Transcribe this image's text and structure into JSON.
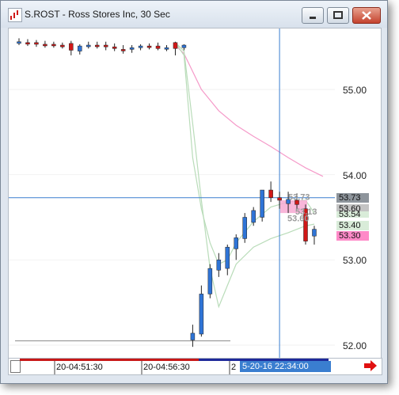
{
  "window": {
    "title": "S.ROST - Ross Stores Inc, 30 Sec",
    "icons": {
      "app": "chart-app-icon",
      "minimize": "minimize-icon",
      "maximize": "maximize-icon",
      "close": "close-icon",
      "scroll_right": "red-arrow-right-icon"
    }
  },
  "price_axis": {
    "ticks": [
      "55.00",
      "54.00",
      "53.00",
      "52.00"
    ],
    "tags": [
      {
        "value": "53.73",
        "color": "#8e959c"
      },
      {
        "value": "53.60",
        "color": "#c4c4c4"
      },
      {
        "value": "53.54",
        "color": "#d9ecd9"
      },
      {
        "value": "53.40",
        "color": "#d9ecd9"
      },
      {
        "value": "53.30",
        "color": "#ff8ac8"
      }
    ]
  },
  "chart_overlay": {
    "labels": [
      "53.73",
      "53.13",
      "53.60"
    ]
  },
  "time_axis": {
    "labels": [
      "20-04:51:30",
      "20-04:56:30",
      "2"
    ],
    "cursor": "5-20-16 22:34:00"
  },
  "colors": {
    "up": "#2f74d6",
    "down": "#d01818",
    "crosshair": "#3a7ed0",
    "ma_pink": "#f59ac9",
    "ma_green": "#b9dcb9"
  },
  "chart_data": {
    "type": "candlestick",
    "ylim": [
      51.9,
      55.9
    ],
    "x_labels": [
      "20-04:51:30",
      "20-04:56:30"
    ],
    "candles": [
      {
        "o": 55.56,
        "h": 55.6,
        "l": 55.52,
        "c": 55.56
      },
      {
        "o": 55.55,
        "h": 55.59,
        "l": 55.51,
        "c": 55.54
      },
      {
        "o": 55.55,
        "h": 55.58,
        "l": 55.5,
        "c": 55.53
      },
      {
        "o": 55.53,
        "h": 55.57,
        "l": 55.49,
        "c": 55.52
      },
      {
        "o": 55.53,
        "h": 55.56,
        "l": 55.49,
        "c": 55.52
      },
      {
        "o": 55.52,
        "h": 55.55,
        "l": 55.48,
        "c": 55.5
      },
      {
        "o": 55.54,
        "h": 55.57,
        "l": 55.4,
        "c": 55.46
      },
      {
        "o": 55.45,
        "h": 55.53,
        "l": 55.41,
        "c": 55.51
      },
      {
        "o": 55.51,
        "h": 55.56,
        "l": 55.48,
        "c": 55.52
      },
      {
        "o": 55.52,
        "h": 55.56,
        "l": 55.48,
        "c": 55.51
      },
      {
        "o": 55.52,
        "h": 55.56,
        "l": 55.46,
        "c": 55.5
      },
      {
        "o": 55.5,
        "h": 55.54,
        "l": 55.45,
        "c": 55.48
      },
      {
        "o": 55.47,
        "h": 55.52,
        "l": 55.42,
        "c": 55.46
      },
      {
        "o": 55.47,
        "h": 55.52,
        "l": 55.43,
        "c": 55.49
      },
      {
        "o": 55.49,
        "h": 55.53,
        "l": 55.46,
        "c": 55.51
      },
      {
        "o": 55.51,
        "h": 55.54,
        "l": 55.47,
        "c": 55.5
      },
      {
        "o": 55.51,
        "h": 55.55,
        "l": 55.46,
        "c": 55.48
      },
      {
        "o": 55.48,
        "h": 55.52,
        "l": 55.45,
        "c": 55.49
      },
      {
        "o": 55.55,
        "h": 55.56,
        "l": 55.4,
        "c": 55.48
      },
      {
        "o": 55.49,
        "h": 55.53,
        "l": 55.46,
        "c": 55.52
      },
      {
        "o": 52.06,
        "h": 52.24,
        "l": 51.98,
        "c": 52.14
      },
      {
        "o": 52.13,
        "h": 52.7,
        "l": 52.1,
        "c": 52.6
      },
      {
        "o": 52.6,
        "h": 52.95,
        "l": 52.55,
        "c": 52.9
      },
      {
        "o": 52.88,
        "h": 53.08,
        "l": 52.8,
        "c": 53.0
      },
      {
        "o": 52.9,
        "h": 53.18,
        "l": 52.82,
        "c": 53.15
      },
      {
        "o": 53.13,
        "h": 53.3,
        "l": 53.0,
        "c": 53.26
      },
      {
        "o": 53.25,
        "h": 53.55,
        "l": 53.2,
        "c": 53.5
      },
      {
        "o": 53.44,
        "h": 53.62,
        "l": 53.4,
        "c": 53.58
      },
      {
        "o": 53.5,
        "h": 53.82,
        "l": 53.45,
        "c": 53.82
      },
      {
        "o": 53.82,
        "h": 53.92,
        "l": 53.68,
        "c": 53.73
      },
      {
        "o": 53.73,
        "h": 53.8,
        "l": 53.6,
        "c": 53.7
      },
      {
        "o": 53.66,
        "h": 53.8,
        "l": 53.55,
        "c": 53.71
      },
      {
        "o": 53.7,
        "h": 53.78,
        "l": 53.6,
        "c": 53.65
      },
      {
        "o": 53.6,
        "h": 53.65,
        "l": 53.18,
        "c": 53.22
      },
      {
        "o": 53.28,
        "h": 53.4,
        "l": 53.18,
        "c": 53.36
      }
    ],
    "ma_pink": [
      [
        18,
        55.52
      ],
      [
        19,
        55.42
      ],
      [
        21,
        55.0
      ],
      [
        23,
        54.75
      ],
      [
        25,
        54.58
      ],
      [
        27,
        54.45
      ],
      [
        29,
        54.33
      ],
      [
        31,
        54.2
      ],
      [
        33,
        54.08
      ],
      [
        35,
        53.98
      ]
    ],
    "ma_green_fast": [
      [
        18,
        55.55
      ],
      [
        19,
        55.4
      ],
      [
        20,
        54.2
      ],
      [
        21,
        53.6
      ],
      [
        22,
        53.2
      ],
      [
        23,
        52.95
      ],
      [
        24,
        53.0
      ],
      [
        25,
        53.2
      ],
      [
        27,
        53.45
      ],
      [
        29,
        53.62
      ],
      [
        31,
        53.68
      ],
      [
        33,
        53.7
      ],
      [
        34,
        53.55
      ]
    ],
    "ma_green_slow": [
      [
        18,
        55.55
      ],
      [
        19,
        55.45
      ],
      [
        20,
        54.6
      ],
      [
        21,
        53.7
      ],
      [
        22,
        52.9
      ],
      [
        23,
        52.45
      ],
      [
        24,
        52.7
      ],
      [
        25,
        52.95
      ],
      [
        27,
        53.15
      ],
      [
        29,
        53.25
      ],
      [
        31,
        53.32
      ],
      [
        33,
        53.4
      ],
      [
        34,
        53.42
      ]
    ],
    "crosshair": {
      "candle": 30,
      "price": 53.73
    },
    "base_line": 52.05
  }
}
